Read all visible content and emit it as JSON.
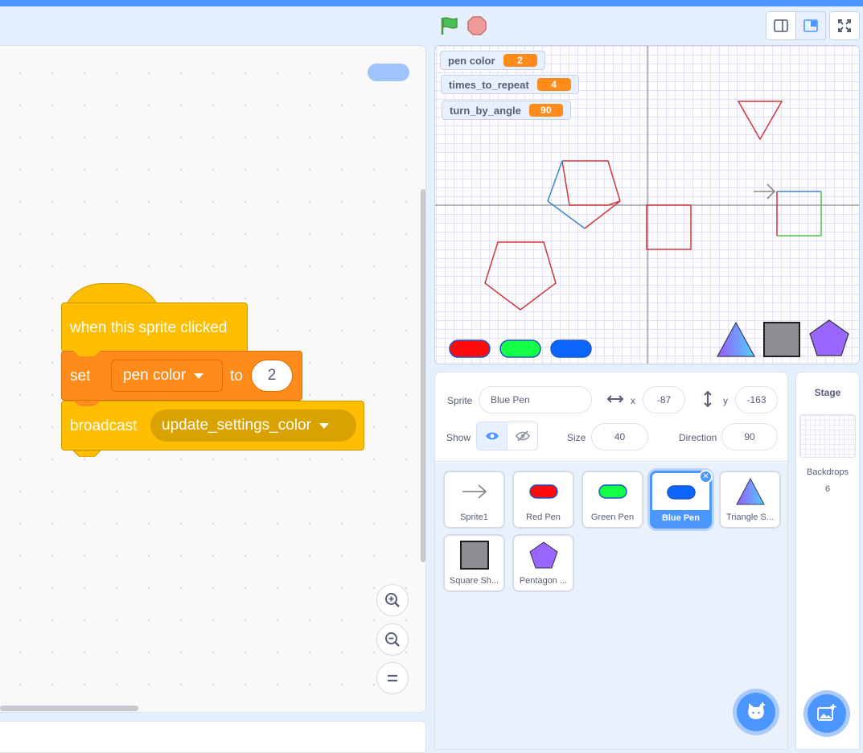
{
  "blocks": {
    "hat_label": "when this sprite clicked",
    "set_label": "set",
    "set_variable": "pen color",
    "to_label": "to",
    "set_value": "2",
    "broadcast_label": "broadcast",
    "broadcast_message": "update_settings_color"
  },
  "zoom": {
    "zoom_in": "+",
    "zoom_out": "−",
    "reset": "="
  },
  "stage": {
    "monitors": [
      {
        "name": "pen color",
        "value": "2"
      },
      {
        "name": "times_to_repeat",
        "value": "4"
      },
      {
        "name": "turn_by_angle",
        "value": "90"
      }
    ]
  },
  "sprite_info": {
    "sprite_label": "Sprite",
    "sprite_name": "Blue Pen",
    "x_label": "x",
    "x_value": "-87",
    "y_label": "y",
    "y_value": "-163",
    "show_label": "Show",
    "size_label": "Size",
    "size_value": "40",
    "direction_label": "Direction",
    "direction_value": "90"
  },
  "sprites": [
    {
      "name": "Sprite1",
      "icon": "arrow-icon"
    },
    {
      "name": "Red Pen",
      "icon": "red-pill-icon",
      "color": "#ff0000"
    },
    {
      "name": "Green Pen",
      "icon": "green-pill-icon",
      "color": "#00ff40"
    },
    {
      "name": "Blue Pen",
      "icon": "blue-pill-icon",
      "color": "#0066ff",
      "selected": true
    },
    {
      "name": "Triangle S...",
      "icon": "triangle-icon"
    },
    {
      "name": "Square Sh...",
      "icon": "square-icon"
    },
    {
      "name": "Pentagon ...",
      "icon": "pentagon-icon"
    }
  ],
  "stage_panel": {
    "title": "Stage",
    "backdrops_label": "Backdrops",
    "backdrops_count": "6"
  },
  "colors": {
    "events": "#ffbf00",
    "variables": "#ff8c1a",
    "accent": "#4c97ff"
  }
}
